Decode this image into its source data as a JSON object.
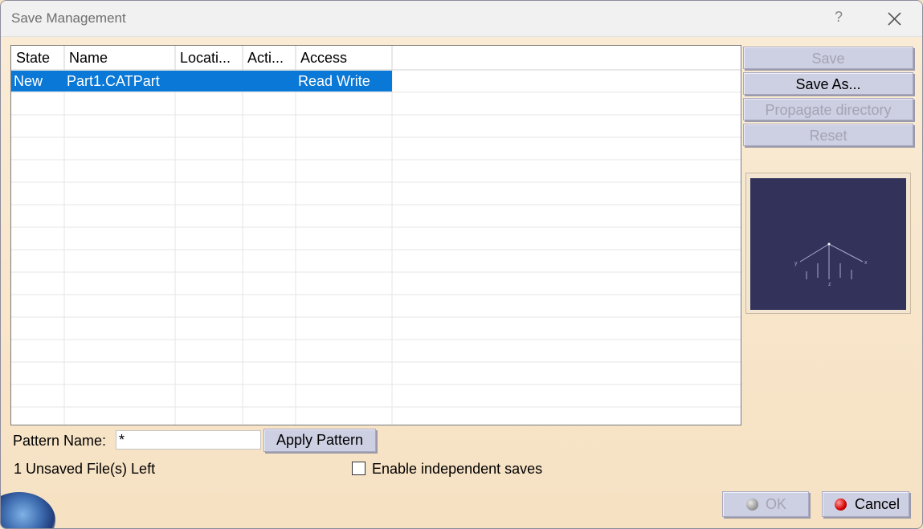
{
  "window": {
    "title": "Save Management",
    "help": "?",
    "close_icon": "close-icon"
  },
  "table": {
    "columns": [
      "State",
      "Name",
      "Locati...",
      "Acti...",
      "Access"
    ],
    "rows": [
      {
        "state": "New",
        "name": "Part1.CATPart",
        "location": "",
        "action": "",
        "access": "Read Write",
        "selected": true
      }
    ],
    "selection_color": "#0a78d7"
  },
  "side_buttons": {
    "save": "Save",
    "save_as": "Save As...",
    "propagate": "Propagate directory",
    "reset": "Reset"
  },
  "preview": {
    "background": "#32325a",
    "axis_x": "x",
    "axis_y": "y",
    "axis_z": "z"
  },
  "pattern": {
    "label": "Pattern Name:",
    "value": "*",
    "apply_label": "Apply Pattern"
  },
  "status": {
    "unsaved": "1 Unsaved File(s) Left",
    "independent_label": "Enable independent saves",
    "independent_checked": false
  },
  "footer": {
    "ok": "OK",
    "cancel": "Cancel"
  }
}
